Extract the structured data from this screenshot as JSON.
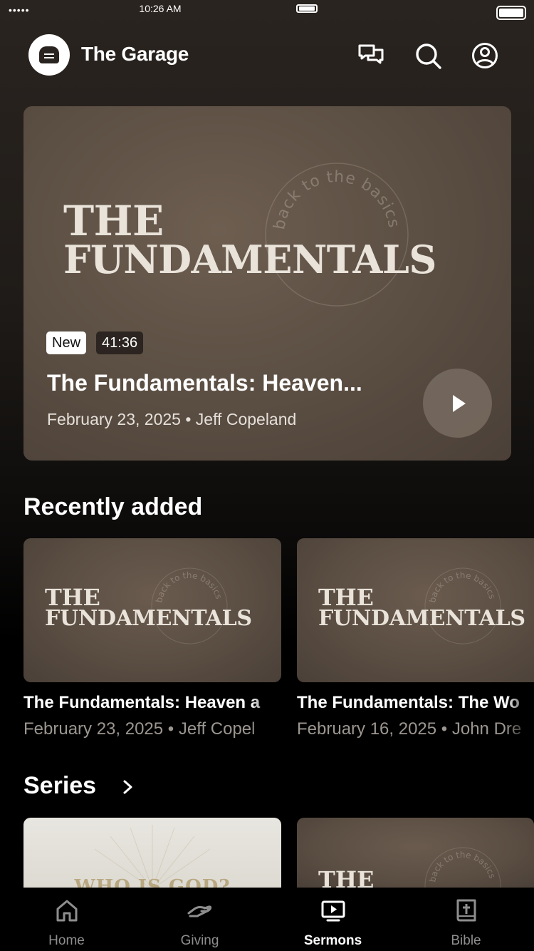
{
  "status_bar": {
    "carrier": "••••• ",
    "time": "10:26 AM"
  },
  "header": {
    "title": "The Garage",
    "icons": [
      "logo-icon",
      "chat-icon",
      "search-icon",
      "profile-icon"
    ]
  },
  "hero": {
    "art_title_line1": "THE",
    "art_title_line2": "FUNDAMENTALS",
    "seal_text": "back to the basics",
    "badge_new": "New",
    "duration": "41:36",
    "title": "The Fundamentals: Heaven...",
    "meta": "February 23, 2025 • Jeff Copeland"
  },
  "recently_added": {
    "heading": "Recently added",
    "items": [
      {
        "art_line1": "THE",
        "art_line2": "FUNDAMENTALS",
        "seal_text": "back to the basics",
        "title": "The Fundamentals: Heaven a",
        "meta": "February 23, 2025 • Jeff Copel"
      },
      {
        "art_line1": "THE",
        "art_line2": "FUNDAMENTALS",
        "seal_text": "back to the basics",
        "title": "The Fundamentals: The Wo",
        "meta": "February 16, 2025 • John Dre"
      }
    ]
  },
  "series": {
    "heading": "Series",
    "items": [
      {
        "art_text": "WHO IS GOD?"
      },
      {
        "art_text": "THE",
        "seal_text": "back to the basics"
      }
    ]
  },
  "tabbar": {
    "tabs": [
      {
        "label": "Home",
        "icon": "home-icon",
        "active": false
      },
      {
        "label": "Giving",
        "icon": "giving-icon",
        "active": false
      },
      {
        "label": "Sermons",
        "icon": "sermons-icon",
        "active": true
      },
      {
        "label": "Bible",
        "icon": "bible-icon",
        "active": false
      }
    ]
  },
  "colors": {
    "inactive_tab": "#8e8e8e",
    "active_tab": "#ffffff",
    "card_brown": "#5d5044"
  }
}
